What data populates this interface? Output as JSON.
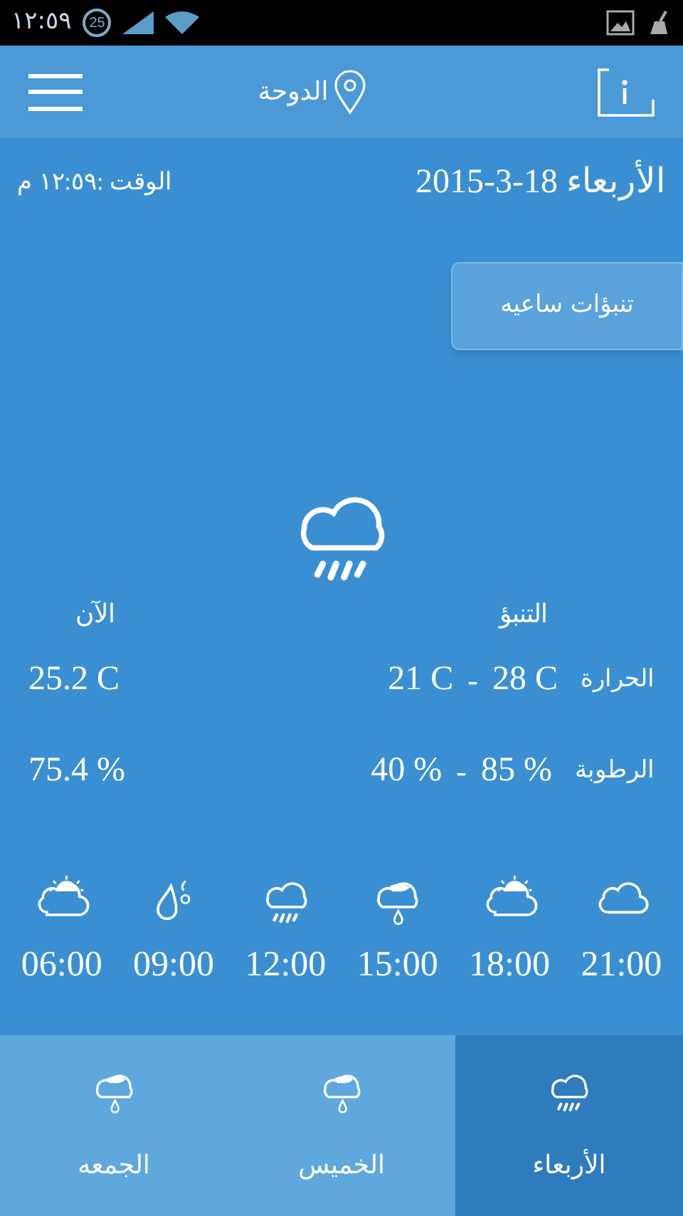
{
  "status_bar": {
    "time": "١٢:٥٩",
    "badge": "25"
  },
  "header": {
    "city": "الدوحة"
  },
  "date": "الأربعاء 18-3-2015",
  "time": "الوقت :١٢:٥٩ م",
  "hourly_button": "تنبؤات ساعيه",
  "current": {
    "kind": "rain"
  },
  "table": {
    "forecast_heading": "التنبؤ",
    "now_heading": "الآن",
    "rows": [
      {
        "label": "الحرارة",
        "high": "28 C",
        "separator": "-",
        "low": "21 C",
        "now": "25.2 C"
      },
      {
        "label": "الرطوبة",
        "high": "85 %",
        "separator": "-",
        "low": "40 %",
        "now": "75.4 %"
      }
    ]
  },
  "hours": [
    {
      "time": "21:00",
      "kind": "cloud"
    },
    {
      "time": "18:00",
      "kind": "sun-cloud"
    },
    {
      "time": "15:00",
      "kind": "drizzle"
    },
    {
      "time": "12:00",
      "kind": "rain"
    },
    {
      "time": "09:00",
      "kind": "drops"
    },
    {
      "time": "06:00",
      "kind": "sun-cloud"
    }
  ],
  "days": [
    {
      "label": "الأربعاء",
      "kind": "rain",
      "selected": true
    },
    {
      "label": "الخميس",
      "kind": "drizzle",
      "selected": false
    },
    {
      "label": "الجمعه",
      "kind": "drizzle",
      "selected": false
    }
  ]
}
